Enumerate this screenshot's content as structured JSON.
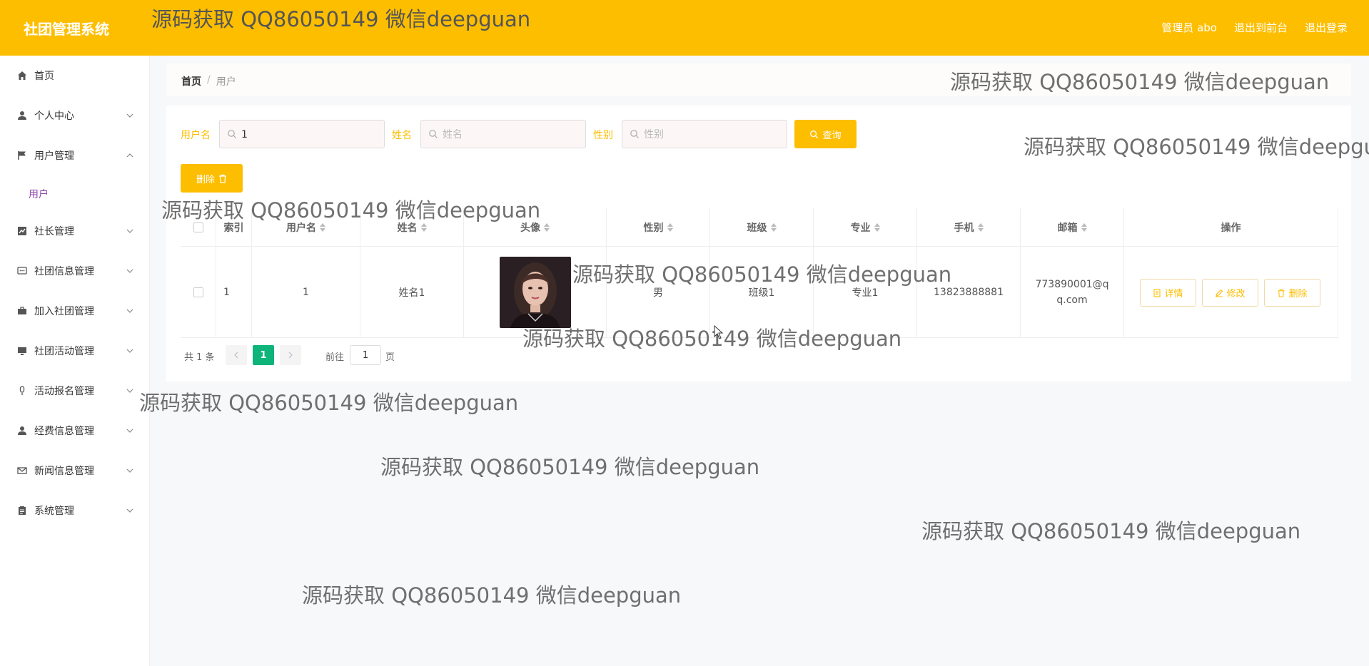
{
  "header": {
    "brand": "社团管理系统",
    "admin": "管理员 abo",
    "to_front": "退出到前台",
    "logout": "退出登录"
  },
  "sidebar": {
    "items": [
      {
        "label": "首页",
        "icon": "home-icon"
      },
      {
        "label": "个人中心",
        "icon": "user-icon"
      },
      {
        "label": "用户管理",
        "icon": "flag-icon",
        "expanded": true
      },
      {
        "label": "社长管理",
        "icon": "chart-icon"
      },
      {
        "label": "社团信息管理",
        "icon": "chat-icon"
      },
      {
        "label": "加入社团管理",
        "icon": "briefcase-icon"
      },
      {
        "label": "社团活动管理",
        "icon": "monitor-icon"
      },
      {
        "label": "活动报名管理",
        "icon": "mic-icon"
      },
      {
        "label": "经费信息管理",
        "icon": "user-icon"
      },
      {
        "label": "新闻信息管理",
        "icon": "mail-icon"
      },
      {
        "label": "系统管理",
        "icon": "clipboard-icon"
      }
    ],
    "sub_user": "用户"
  },
  "breadcrumb": {
    "home": "首页",
    "sep": "/",
    "current": "用户"
  },
  "search": {
    "username_label": "用户名",
    "username_value": "1",
    "name_label": "姓名",
    "name_placeholder": "姓名",
    "gender_label": "性别",
    "gender_placeholder": "性别",
    "query_button": "查询"
  },
  "actions": {
    "delete_button": "删除"
  },
  "table": {
    "columns": [
      "索引",
      "用户名",
      "姓名",
      "头像",
      "性别",
      "班级",
      "专业",
      "手机",
      "邮箱",
      "操作"
    ],
    "rows": [
      {
        "index": "1",
        "username": "1",
        "name": "姓名1",
        "gender": "男",
        "class": "班级1",
        "major": "专业1",
        "phone": "13823888881",
        "email": "773890001@qq.com",
        "ops": {
          "detail": "详情",
          "edit": "修改",
          "delete": "删除"
        }
      }
    ]
  },
  "pagination": {
    "total": "共 1 条",
    "current_page": "1",
    "goto_label": "前往",
    "goto_value": "1",
    "page_suffix": "页"
  },
  "watermark": "源码获取 QQ86050149 微信deepguan",
  "colors": {
    "accent": "#fdbe00",
    "active_page": "#0fb47b",
    "submenu": "#8e44ad"
  }
}
